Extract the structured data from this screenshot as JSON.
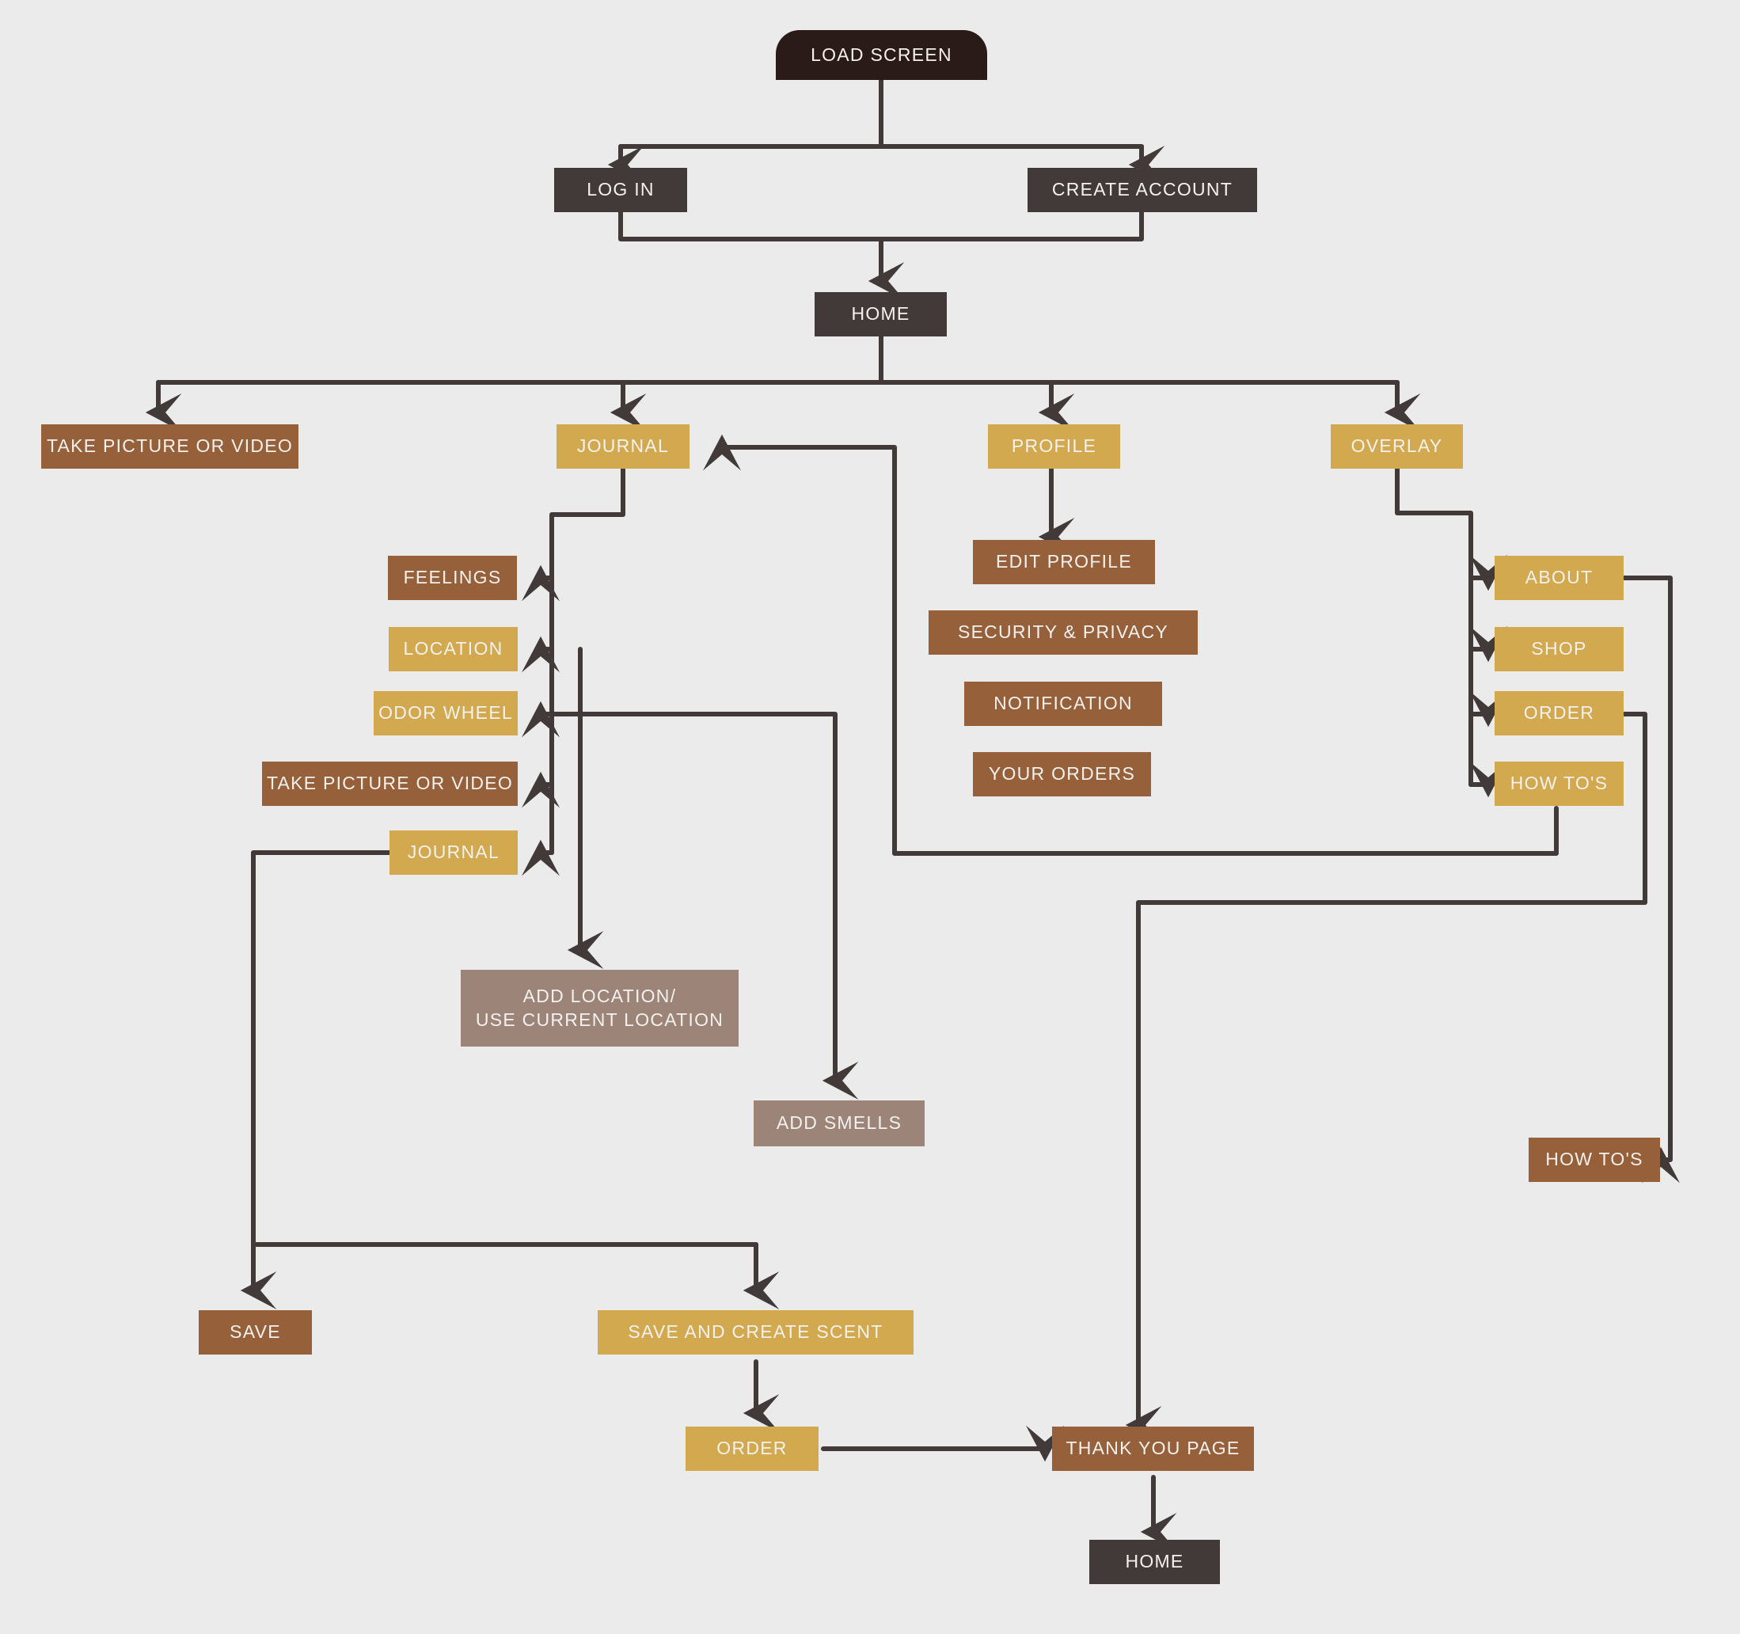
{
  "diagram": {
    "title": "App Navigation Flow",
    "background_color": "#ebebeb",
    "connector_color": "#423a39",
    "palette": {
      "darkest": "#2a1a18",
      "dark": "#423a39",
      "brown": "#96603a",
      "tan": "#d2a94e",
      "mauve": "#9c8478"
    }
  },
  "nodes": {
    "load_screen": "LOAD SCREEN",
    "log_in": "LOG IN",
    "create_account": "CREATE ACCOUNT",
    "home_top": "HOME",
    "take_picture_or_video_top": "TAKE PICTURE OR VIDEO",
    "journal_top": "JOURNAL",
    "profile": "PROFILE",
    "overlay": "OVERLAY",
    "feelings": "FEELINGS",
    "location": "LOCATION",
    "odor_wheel": "ODOR WHEEL",
    "take_picture_or_video_sub": "TAKE PICTURE OR VIDEO",
    "journal_sub": "JOURNAL",
    "edit_profile": "EDIT PROFILE",
    "security_privacy": "SECURITY & PRIVACY",
    "notification": "NOTIFICATION",
    "your_orders": "YOUR ORDERS",
    "about": "ABOUT",
    "shop": "SHOP",
    "order_overlay": "ORDER",
    "how_tos_overlay": "HOW TO'S",
    "add_location": "ADD LOCATION/\nUSE CURRENT LOCATION",
    "add_smells": "ADD SMELLS",
    "how_tos_bottom": "HOW TO'S",
    "save": "SAVE",
    "save_and_create_scent": "SAVE AND CREATE SCENT",
    "order_bottom": "ORDER",
    "thank_you_page": "THANK YOU PAGE",
    "home_bottom": "HOME"
  }
}
